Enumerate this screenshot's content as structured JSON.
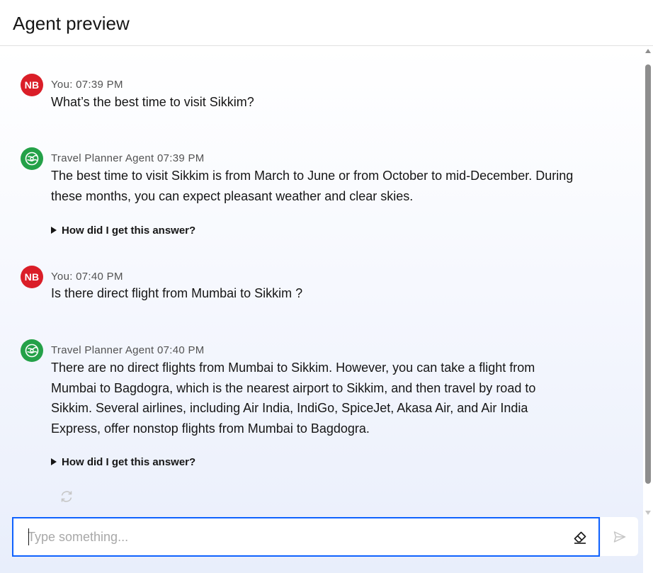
{
  "header": {
    "title": "Agent preview"
  },
  "messages": [
    {
      "role": "user",
      "avatar_initials": "NB",
      "meta": "You: 07:39 PM",
      "text": "What’s the best time to visit Sikkim?"
    },
    {
      "role": "agent",
      "avatar_icon": "agent-globe-icon",
      "meta": "Travel Planner Agent 07:39 PM",
      "text": "The best time to visit Sikkim is from March to June or from October to mid-December. During these months, you can expect pleasant weather and clear skies.",
      "disclosure": "How did I get this answer?"
    },
    {
      "role": "user",
      "avatar_initials": "NB",
      "meta": "You: 07:40 PM",
      "text": "Is there direct flight from Mumbai to Sikkim ?"
    },
    {
      "role": "agent",
      "avatar_icon": "agent-globe-icon",
      "meta": "Travel Planner Agent 07:40 PM",
      "text": "There are no direct flights from Mumbai to Sikkim. However, you can take a flight from Mumbai to Bagdogra, which is the nearest airport to Sikkim, and then travel by road to Sikkim. Several airlines, including Air India, IndiGo, SpiceJet, Akasa Air, and Air India Express, offer nonstop flights from Mumbai to Bagdogra.",
      "disclosure": "How did I get this answer?"
    }
  ],
  "composer": {
    "placeholder": "Type something...",
    "value": "",
    "clear_icon": "eraser-icon",
    "send_icon": "send-icon",
    "regenerate_icon": "refresh-icon"
  },
  "colors": {
    "user_avatar": "#da1e28",
    "agent_avatar": "#24a148",
    "focus_border": "#0f62fe"
  }
}
